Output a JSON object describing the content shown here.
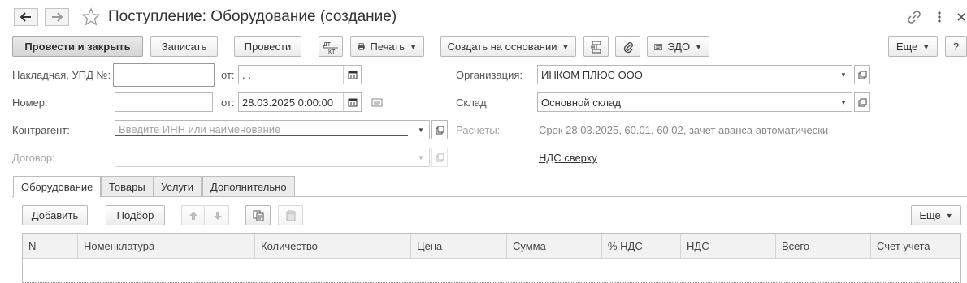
{
  "header": {
    "title": "Поступление: Оборудование (создание)"
  },
  "toolbar": {
    "post_close": "Провести и закрыть",
    "save": "Записать",
    "post": "Провести",
    "dt_kt": "Дт/Кт",
    "print": "Печать",
    "create_based": "Создать на основании",
    "edo": "ЭДО",
    "more": "Еще",
    "help": "?"
  },
  "form": {
    "invoice_label": "Накладная, УПД №:",
    "invoice_value": "",
    "invoice_date_label": "от:",
    "invoice_date_value": "  .  .",
    "number_label": "Номер:",
    "number_value": "",
    "number_date_label": "от:",
    "number_date_value": "28.03.2025  0:00:00",
    "counterparty_label": "Контрагент:",
    "counterparty_placeholder": "Введите ИНН или наименование",
    "contract_label": "Договор:",
    "contract_value": "",
    "org_label": "Организация:",
    "org_value": "ИНКОМ ПЛЮС ООО",
    "warehouse_label": "Склад:",
    "warehouse_value": "Основной склад",
    "settlements_label": "Расчеты:",
    "settlements_value": "Срок 28.03.2025, 60.01, 60.02, зачет аванса автоматически",
    "vat_link": "НДС сверху"
  },
  "tabs": [
    {
      "label": "Оборудование",
      "active": true
    },
    {
      "label": "Товары",
      "active": false
    },
    {
      "label": "Услуги",
      "active": false
    },
    {
      "label": "Дополнительно",
      "active": false
    }
  ],
  "table_toolbar": {
    "add": "Добавить",
    "select": "Подбор",
    "more": "Еще"
  },
  "table": {
    "columns": [
      "N",
      "Номенклатура",
      "Количество",
      "Цена",
      "Сумма",
      "% НДС",
      "НДС",
      "Всего",
      "Счет учета"
    ],
    "rows": []
  }
}
